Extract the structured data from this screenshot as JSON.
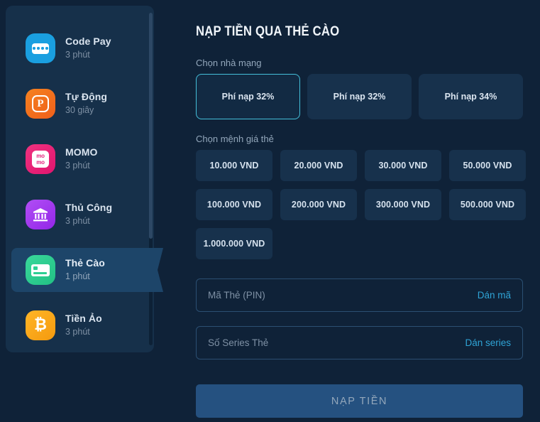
{
  "sidebar": {
    "items": [
      {
        "title": "Code Pay",
        "subtitle": "3 phút",
        "icon": "codepay-icon",
        "color": "#1a9fe0",
        "selected": false
      },
      {
        "title": "Tự Động",
        "subtitle": "30 giây",
        "icon": "payoo-icon",
        "color": "#f0701e",
        "selected": false
      },
      {
        "title": "MOMO",
        "subtitle": "3 phút",
        "icon": "momo-icon",
        "color": "#e4217c",
        "selected": false
      },
      {
        "title": "Thủ Công",
        "subtitle": "3 phút",
        "icon": "bank-icon",
        "color": "#a23df0",
        "selected": false
      },
      {
        "title": "Thẻ Cào",
        "subtitle": "1 phút",
        "icon": "scratch-card-icon",
        "color": "#2ecf93",
        "selected": true
      },
      {
        "title": "Tiền Ảo",
        "subtitle": "3 phút",
        "icon": "bitcoin-icon",
        "color": "#f5a623",
        "selected": false
      }
    ],
    "glyphs": {
      "payoo": "P",
      "momo_top": "mo",
      "momo_bottom": "mo",
      "bitcoin": "₿"
    }
  },
  "main": {
    "title": "NẠP TIỀN QUA THẺ CÀO",
    "network_label": "Chọn nhà mạng",
    "networks": [
      {
        "label": "Phí nạp 32%",
        "selected": true
      },
      {
        "label": "Phí nạp 32%",
        "selected": false
      },
      {
        "label": "Phí nạp 34%",
        "selected": false
      }
    ],
    "denom_label": "Chọn mệnh giá thẻ",
    "denominations": [
      "10.000 VND",
      "20.000 VND",
      "30.000 VND",
      "50.000 VND",
      "100.000 VND",
      "200.000 VND",
      "300.000 VND",
      "500.000 VND",
      "1.000.000 VND"
    ],
    "pin_field": {
      "placeholder": "Mã Thẻ (PIN)",
      "value": "",
      "action": "Dán mã"
    },
    "series_field": {
      "placeholder": "Số Series Thẻ",
      "value": "",
      "action": "Dán series"
    },
    "submit_label": "NẠP TIỀN"
  },
  "colors": {
    "page_bg": "#0f2238",
    "panel_bg": "#16304a",
    "selected_nav_bg": "#1d4569",
    "accent_cyan": "#44bfd9",
    "link_cyan": "#2fa4d6",
    "submit_bg": "#255180"
  }
}
